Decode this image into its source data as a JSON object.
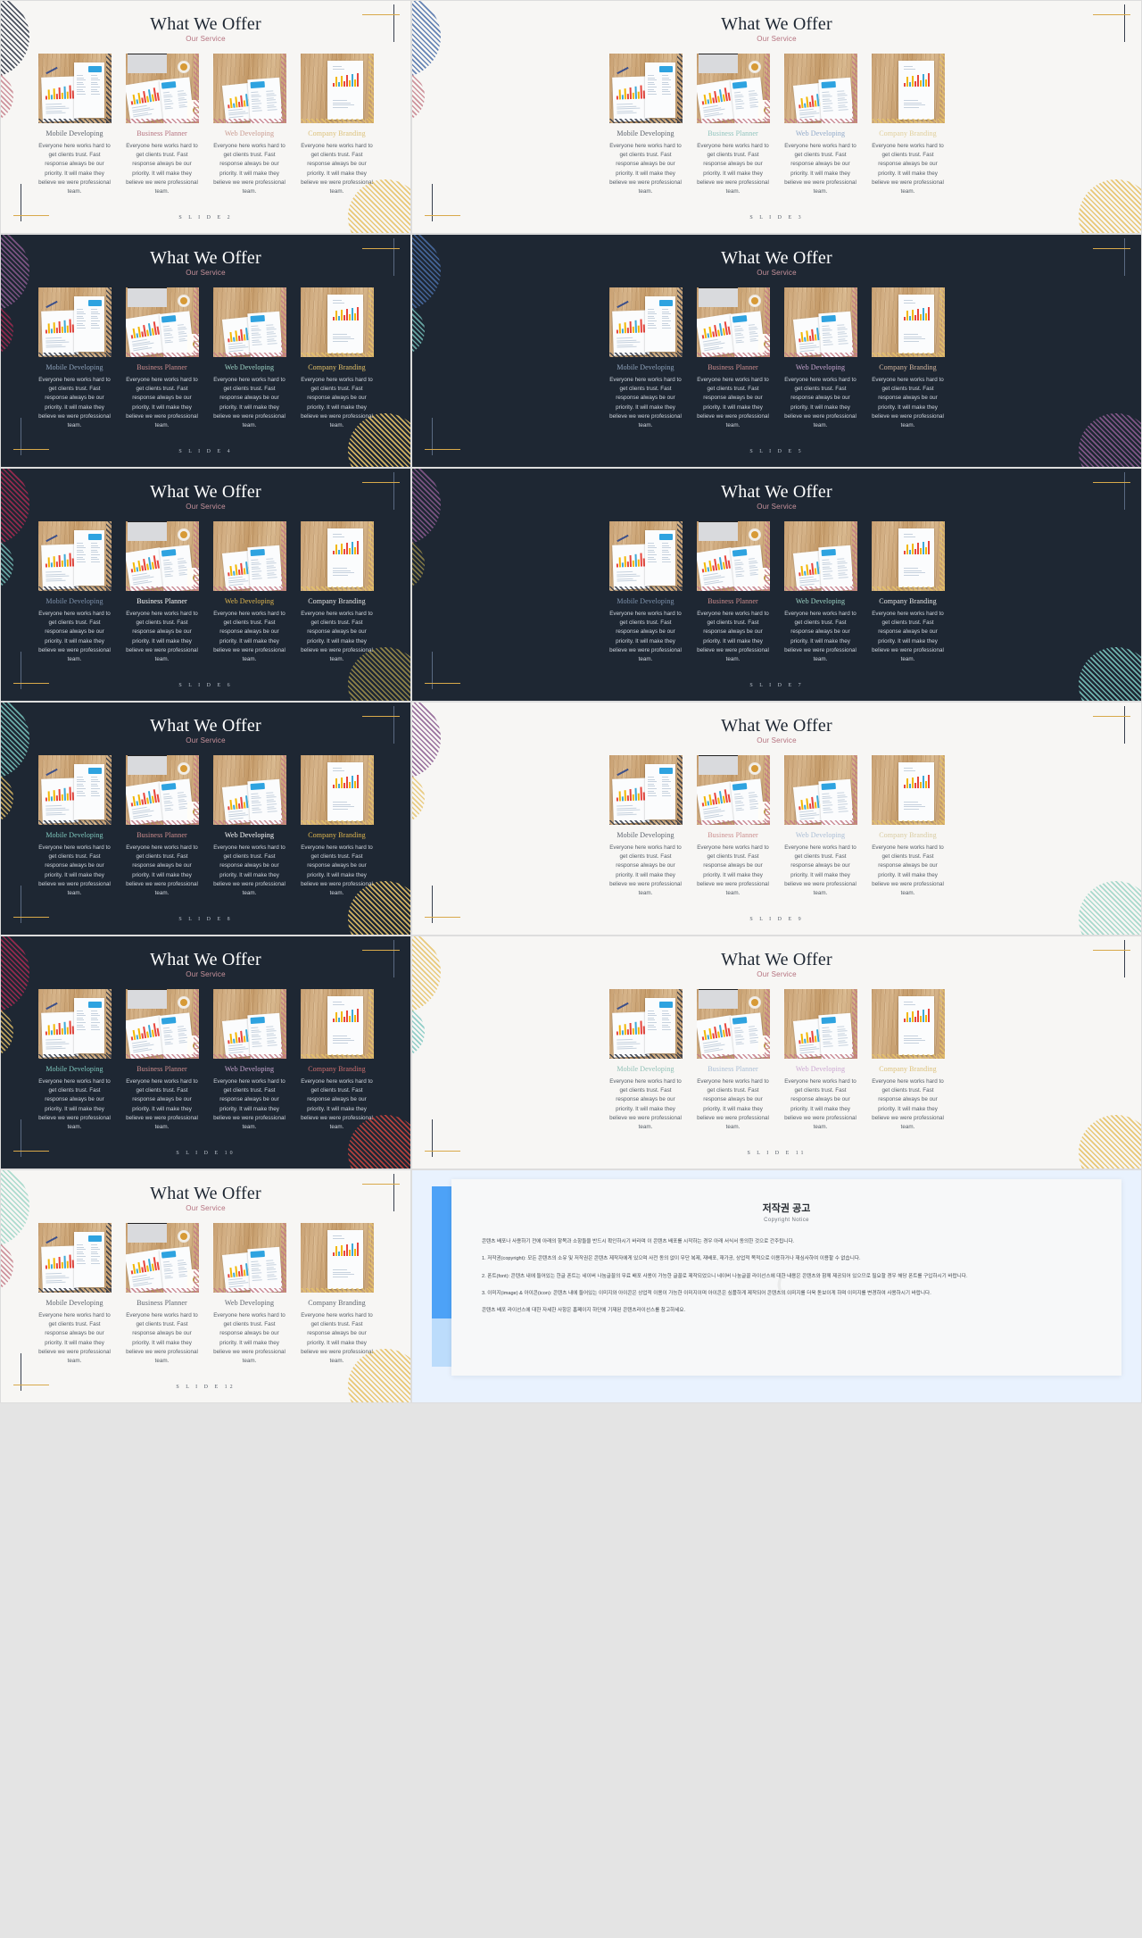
{
  "deck": {
    "title": "What We Offer",
    "subtitle": "Our Service",
    "card_desc": "Everyone here works hard to get clients trust. Fast response always be our priority. It will make they believe we were professional team.",
    "cards": [
      {
        "title": "Mobile Developing",
        "photo": "mobile-developing-photo"
      },
      {
        "title": "Business Planner",
        "photo": "business-planner-photo"
      },
      {
        "title": "Web Developing",
        "photo": "web-developing-photo"
      },
      {
        "title": "Company Branding",
        "photo": "company-branding-photo"
      }
    ]
  },
  "slides": [
    {
      "label": "S L I D E   2",
      "theme": "light",
      "title_colors": [
        "#5d646e",
        "#b4707d",
        "#c99a90",
        "#dcc17a"
      ],
      "deco": {
        "tl": "stripes-navy",
        "tl2": "stripes-rose",
        "br": "stripes-gold"
      }
    },
    {
      "label": "S L I D E   3",
      "theme": "light",
      "title_colors": [
        "#5d646e",
        "#8fc3bd",
        "#8fa8c9",
        "#e0cf9a"
      ],
      "deco": {
        "tl": "stripes-blue",
        "tl2": "stripes-rose",
        "br": "stripes-gold"
      }
    },
    {
      "label": "S L I D E   4",
      "theme": "dark",
      "title_colors": [
        "#8fa3bb",
        "#cf8e8e",
        "#9fd6c7",
        "#e6c268"
      ],
      "deco": {
        "tl": "stripes-purple",
        "tl2": "stripes-crim",
        "br": "stripes-gold"
      }
    },
    {
      "label": "S L I D E   5",
      "theme": "dark",
      "title_colors": [
        "#8fa3bb",
        "#cf8e8e",
        "#c9a6d0",
        "#d8b9a0"
      ],
      "deco": {
        "tl": "stripes-blue",
        "tl2": "stripes-teal",
        "br": "stripes-purple"
      }
    },
    {
      "label": "S L I D E   6",
      "theme": "dark",
      "title_colors": [
        "#7f93ad",
        "#ffffff",
        "#e2b84f",
        "#e8e8e8"
      ],
      "deco": {
        "tl": "stripes-crim",
        "tl2": "stripes-teal",
        "br": "stripes-olive"
      }
    },
    {
      "label": "S L I D E   7",
      "theme": "dark",
      "title_colors": [
        "#7f93ad",
        "#cf8e8e",
        "#9fd6c7",
        "#e8e8e8"
      ],
      "deco": {
        "tl": "stripes-purple",
        "tl2": "stripes-olive",
        "br": "stripes-teal"
      }
    },
    {
      "label": "S L I D E   8",
      "theme": "dark",
      "title_colors": [
        "#7fc8bd",
        "#cf8e8e",
        "#ffffff",
        "#e2b84f"
      ],
      "deco": {
        "tl": "stripes-teal",
        "tl2": "stripes-gold",
        "br": "stripes-gold"
      }
    },
    {
      "label": "S L I D E   9",
      "theme": "light",
      "title_colors": [
        "#5d646e",
        "#c98b8b",
        "#a8bcd4",
        "#d8cba0"
      ],
      "deco": {
        "tl": "stripes-purple",
        "tl2": "stripes-gold",
        "br": "stripes-mint"
      }
    },
    {
      "label": "S L I D E   10",
      "theme": "dark",
      "title_colors": [
        "#7fc8bd",
        "#cf8e8e",
        "#c8a6cf",
        "#cf6f6f"
      ],
      "deco": {
        "tl": "stripes-crim",
        "tl2": "stripes-gold",
        "br": "stripes-red"
      }
    },
    {
      "label": "S L I D E   11",
      "theme": "light",
      "title_colors": [
        "#8fbfb5",
        "#a8bcd4",
        "#c9a6d0",
        "#dcc17a"
      ],
      "deco": {
        "tl": "stripes-gold",
        "tl2": "stripes-teal",
        "br": "stripes-gold"
      }
    },
    {
      "label": "S L I D E   12",
      "theme": "light",
      "title_colors": [
        "#5d646e",
        "#5d646e",
        "#5d646e",
        "#5d646e"
      ],
      "deco": {
        "tl": "stripes-mint",
        "tl2": "stripes-rose",
        "br": "stripes-gold"
      }
    }
  ],
  "copyright": {
    "title": "저작권 공고",
    "subtitle": "Copyright Notice",
    "watermark": "C",
    "intro": "콘텐츠 배포나 사용하기 전에 아래의 항목과 소항들을 반드시 확인하시기 바라며 이 콘텐츠 배포를 시작하는 경우 아래 서식서 동의한 것으로 간주됩니다.",
    "items": [
      "1. 저작권(copyright): 모든 콘텐츠의 소유 및 저작권은 콘텐츠 제작자에게 있으며 사전 동의 없이 무단 복제, 재배포, 재가공, 상업적 목적으로 이용하거나 재심사하여 이용할 수 없습니다.",
      "2. 폰트(font): 콘텐츠 내에 들어있는 한글 폰트는 네이버 나눔글꼴의 무료 배포 사용이 가능한 글꼴로 제작되었으니 네이버 나눔글꼴 라이선스에 대한 내용은 콘텐츠와 함께 제공되어 있으므로 필요할 경우 해당 폰트를 구입하시기 바랍니다.",
      "3. 이미지(image) & 아이콘(icon): 콘텐츠 내에 들어있는 이미지와 아이콘은 상업적 이용이 가능한 이미지이며 아이콘은 심플하게 제작되어 콘텐츠의 이미지를 더욱 돋보이게 하며 이미지를 변경하여 사용하시기 바랍니다."
    ],
    "footer": "콘텐츠 배포 라이선스에 대한 자세한 사항은 홈페이지 하단에 기재된 콘텐츠라이선스를 참고하세요."
  }
}
